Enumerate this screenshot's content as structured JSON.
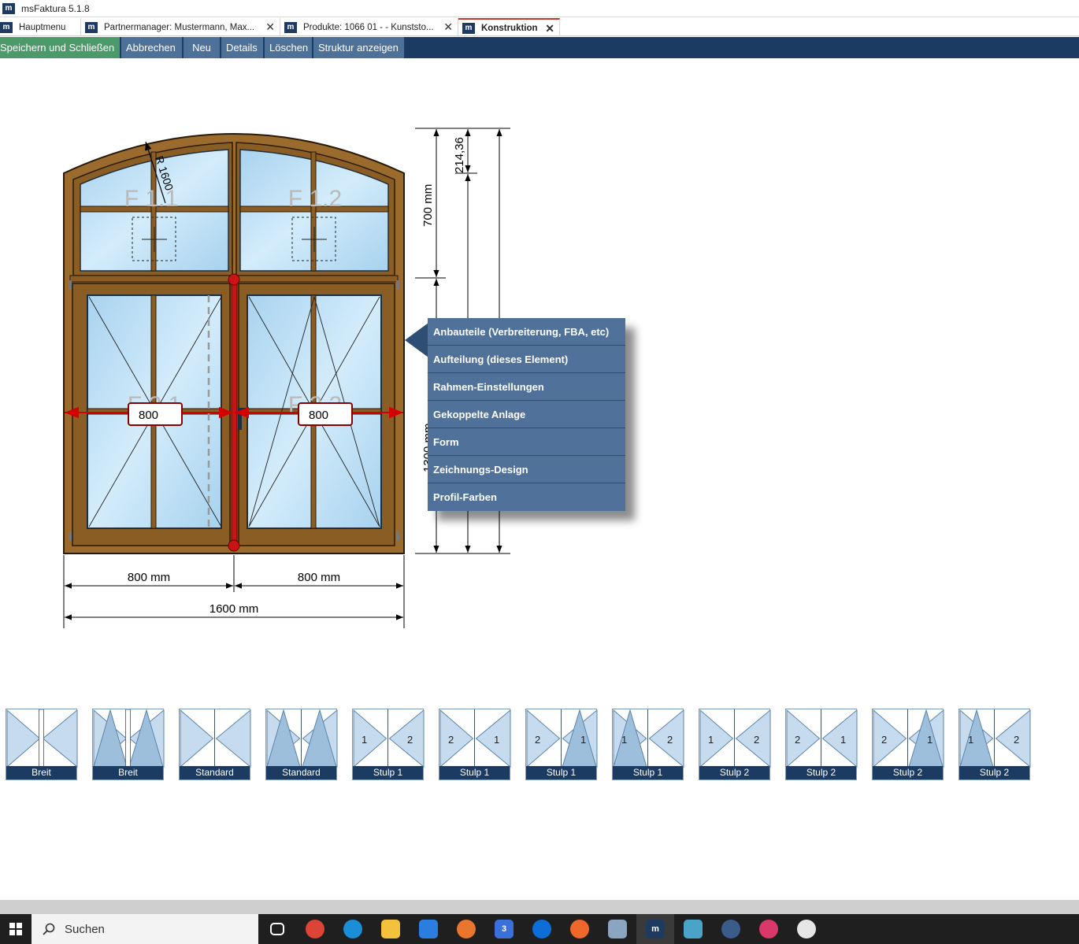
{
  "window": {
    "title": "msFaktura 5.1.8",
    "logo_text": "m"
  },
  "tabs": [
    {
      "label": "Hauptmenu",
      "closable": false,
      "active": false
    },
    {
      "label": "Partnermanager: Mustermann, Max...",
      "closable": true,
      "active": false
    },
    {
      "label": "Produkte: 1066 01 - - Kunststo...",
      "closable": true,
      "active": false
    },
    {
      "label": "Konstruktion",
      "closable": true,
      "active": true
    }
  ],
  "toolbar": {
    "save_close": "Speichern und Schließen",
    "cancel": "Abbrechen",
    "new": "Neu",
    "details": "Details",
    "delete": "Löschen",
    "show_structure": "Struktur anzeigen"
  },
  "drawing": {
    "radius_label": "R 1600",
    "fields": {
      "f11": "F 1.1",
      "f12": "F 1.2",
      "f21": "F 2.1",
      "f22": "F 2.2"
    },
    "width_inputs": {
      "left": "800",
      "right": "800"
    },
    "dims_bottom": {
      "left": "800 mm",
      "right": "800 mm",
      "total": "1600 mm"
    },
    "dims_right": {
      "arch": "214,36",
      "top": "700 mm",
      "bottom": "1300 mm"
    }
  },
  "context_menu": {
    "items": [
      "Anbauteile (Verbreiterung, FBA, etc)",
      "Aufteilung (dieses Element)",
      "Rahmen-Einstellungen",
      "Gekoppelte Anlage",
      "Form",
      "Zeichnungs-Design",
      "Profil-Farben"
    ]
  },
  "templates": [
    {
      "label": "Breit",
      "left": "",
      "right": "",
      "style": "breit"
    },
    {
      "label": "Breit",
      "left": "",
      "right": "",
      "style": "breit-tilt"
    },
    {
      "label": "Standard",
      "left": "",
      "right": "",
      "style": "std"
    },
    {
      "label": "Standard",
      "left": "",
      "right": "",
      "style": "std-tilt"
    },
    {
      "label": "Stulp 1",
      "left": "1",
      "right": "2",
      "style": "std"
    },
    {
      "label": "Stulp 1",
      "left": "2",
      "right": "1",
      "style": "std"
    },
    {
      "label": "Stulp 1",
      "left": "2",
      "right": "1",
      "style": "right-tilt"
    },
    {
      "label": "Stulp 1",
      "left": "1",
      "right": "2",
      "style": "left-tilt"
    },
    {
      "label": "Stulp 2",
      "left": "1",
      "right": "2",
      "style": "std"
    },
    {
      "label": "Stulp 2",
      "left": "2",
      "right": "1",
      "style": "std"
    },
    {
      "label": "Stulp 2",
      "left": "2",
      "right": "1",
      "style": "right-tilt"
    },
    {
      "label": "Stulp 2",
      "left": "1",
      "right": "2",
      "style": "left-tilt"
    }
  ],
  "taskbar": {
    "search_text": "Suchen",
    "apps": [
      {
        "name": "task-view",
        "color": "#1f1f1f",
        "text": ""
      },
      {
        "name": "chrome",
        "color": "#db4437",
        "text": ""
      },
      {
        "name": "edge",
        "color": "#1a8fd8",
        "text": ""
      },
      {
        "name": "explorer",
        "color": "#f3c13a",
        "text": ""
      },
      {
        "name": "store",
        "color": "#2b7de0",
        "text": ""
      },
      {
        "name": "app-orange",
        "color": "#e8762c",
        "text": ""
      },
      {
        "name": "teams-badge",
        "color": "#3b6fd9",
        "text": "3"
      },
      {
        "name": "teamviewer",
        "color": "#0e6ed8",
        "text": ""
      },
      {
        "name": "firefox",
        "color": "#f0672b",
        "text": ""
      },
      {
        "name": "tools",
        "color": "#8ba4c0",
        "text": ""
      },
      {
        "name": "msfaktura",
        "color": "#1f3a60",
        "text": "m"
      },
      {
        "name": "notes",
        "color": "#4aa3c9",
        "text": ""
      },
      {
        "name": "keepass",
        "color": "#3a5c8a",
        "text": ""
      },
      {
        "name": "creative-cloud",
        "color": "#d9386a",
        "text": ""
      },
      {
        "name": "teamviewer-2",
        "color": "#e6e6e6",
        "text": ""
      }
    ]
  }
}
